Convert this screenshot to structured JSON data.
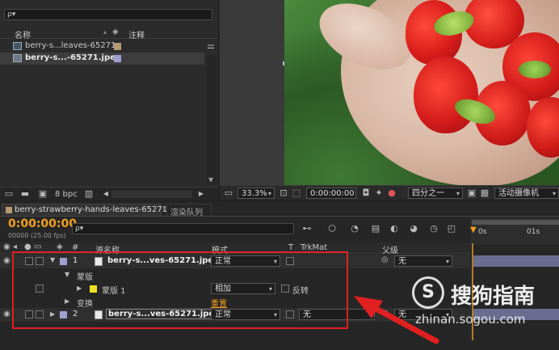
{
  "project": {
    "search_placeholder": "",
    "search_icon_glyph": "ρ▾",
    "col_name": "名称",
    "col_comment": "注释",
    "items": [
      {
        "name": "berry-s...leaves-65271",
        "swatch": "#b59a72"
      },
      {
        "name": "berry-s...-65271.jpeg",
        "swatch": "#a0a0d0"
      }
    ],
    "bpc": "8 bpc"
  },
  "viewer": {
    "zoom": "33.3%",
    "timecode": "0:00:00:00",
    "resolution": "四分之一",
    "camera": "活动摄像机"
  },
  "timeline": {
    "tab_comp": "berry-strawberry-hands-leaves-65271",
    "tab_render": "渲染队列",
    "timecode": "0:00:00:00",
    "fps": "00000 (25.00 fps)",
    "ruler": [
      "0s",
      "01s"
    ],
    "headers": {
      "num": "#",
      "source_name": "源名称",
      "mode": "模式",
      "t": "T",
      "trkmat": "TrkMat",
      "parent": "父级"
    },
    "layers": [
      {
        "num": "1",
        "name": "berry-s...ves-65271.jpeg",
        "mode": "正常",
        "parent": "无",
        "swatch": "#a0a0d0"
      },
      {
        "num": "2",
        "name": "berry-s...ves-65271.jpeg",
        "mode": "正常",
        "trkmat": "无",
        "parent": "无",
        "swatch": "#a0a0d0"
      }
    ],
    "masks_group": "蒙版",
    "mask": {
      "name": "蒙版 1",
      "mode": "相加",
      "invert": "反转",
      "swatch": "#f0e020"
    },
    "transform": "变换",
    "reset": "重置"
  },
  "watermark": {
    "brand": "搜狗指南",
    "url": "zhinan.sogou.com"
  },
  "colors": {
    "accent_orange": "#f0a020",
    "highlight_red": "#e02020"
  }
}
